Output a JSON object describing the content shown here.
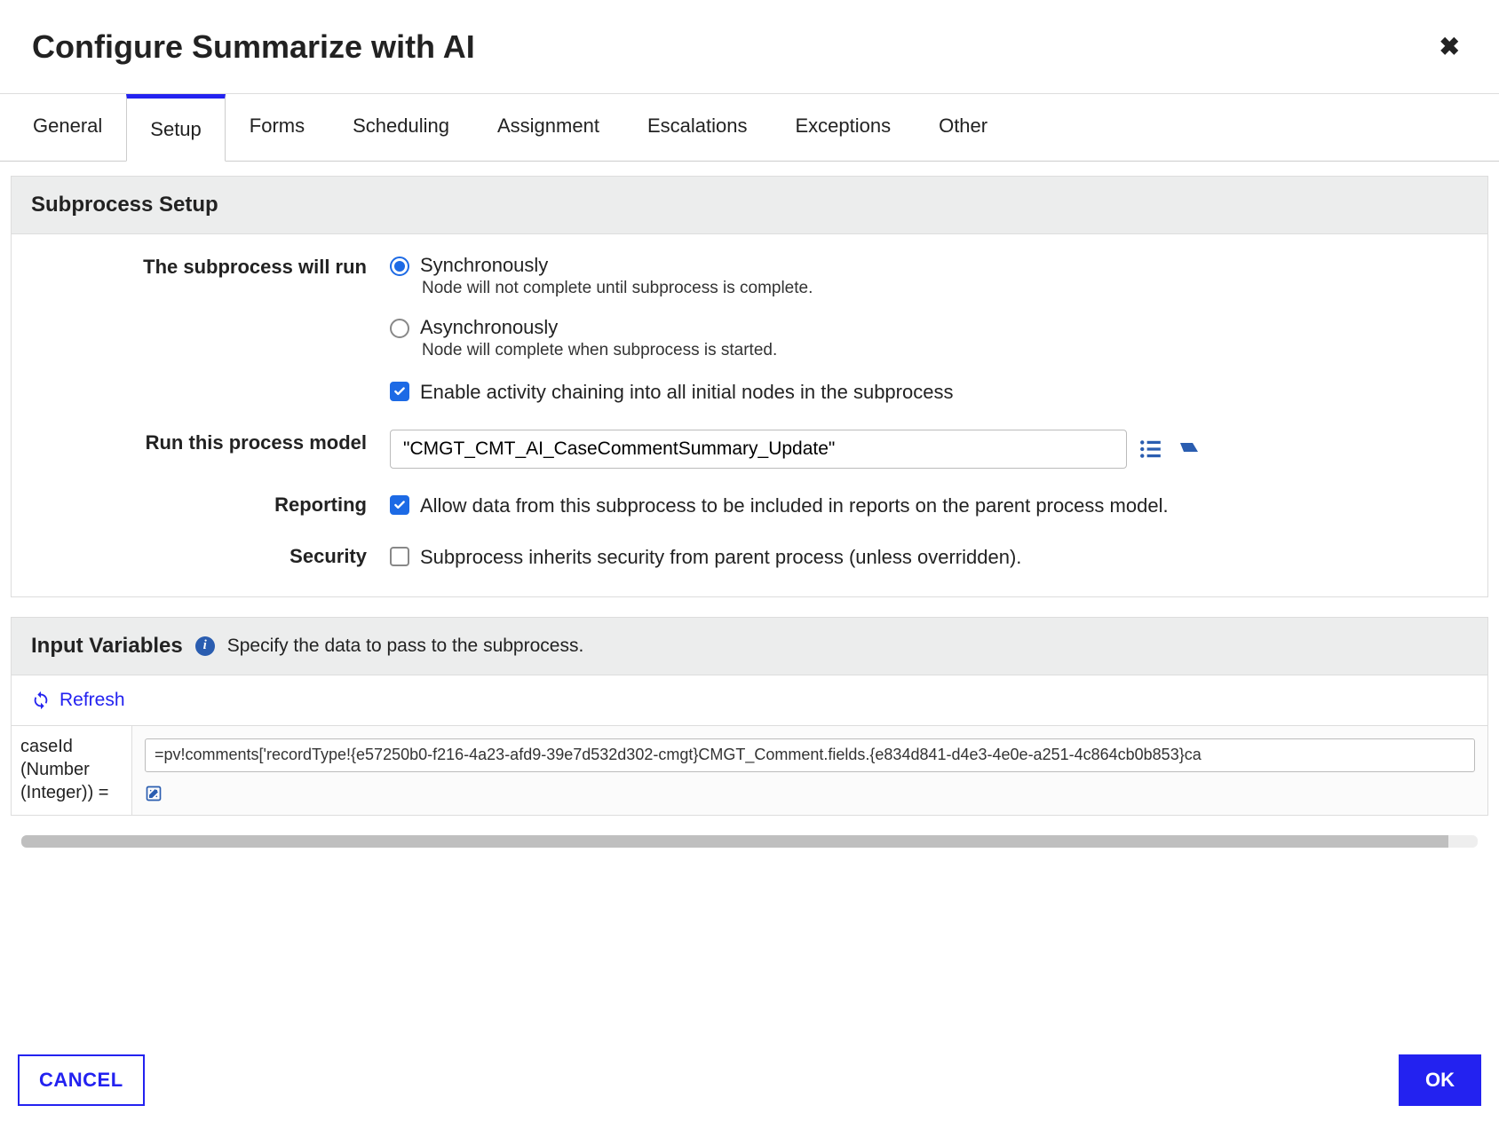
{
  "dialog": {
    "title": "Configure Summarize with AI"
  },
  "tabs": [
    "General",
    "Setup",
    "Forms",
    "Scheduling",
    "Assignment",
    "Escalations",
    "Exceptions",
    "Other"
  ],
  "active_tab_index": 1,
  "subprocess_setup": {
    "section_title": "Subprocess Setup",
    "run_mode_label": "The subprocess will run",
    "sync": {
      "label": "Synchronously",
      "hint": "Node will not complete until subprocess is complete.",
      "selected": true
    },
    "async": {
      "label": "Asynchronously",
      "hint": "Node will complete when subprocess is started.",
      "selected": false
    },
    "chaining": {
      "label": "Enable activity chaining into all initial nodes in the subprocess",
      "checked": true
    },
    "process_model_label": "Run this process model",
    "process_model_value": "\"CMGT_CMT_AI_CaseCommentSummary_Update\"",
    "reporting_label": "Reporting",
    "reporting_checkbox": {
      "label": "Allow data from this subprocess to be included in reports on the parent process model.",
      "checked": true
    },
    "security_label": "Security",
    "security_checkbox": {
      "label": "Subprocess inherits security from parent process (unless overridden).",
      "checked": false
    }
  },
  "input_vars": {
    "section_title": "Input Variables",
    "subtitle": "Specify the data to pass to the subprocess.",
    "refresh_label": "Refresh",
    "rows": [
      {
        "name": "caseId (Number (Integer)) =",
        "value": "=pv!comments['recordType!{e57250b0-f216-4a23-afd9-39e7d532d302-cmgt}CMGT_Comment.fields.{e834d841-d4e3-4e0e-a251-4c864cb0b853}ca"
      }
    ]
  },
  "buttons": {
    "cancel": "CANCEL",
    "ok": "OK"
  },
  "icons": {
    "close": "close-icon",
    "list": "list-icon",
    "erase": "erase-icon",
    "info": "info-icon",
    "refresh": "refresh-icon",
    "edit": "edit-icon"
  }
}
